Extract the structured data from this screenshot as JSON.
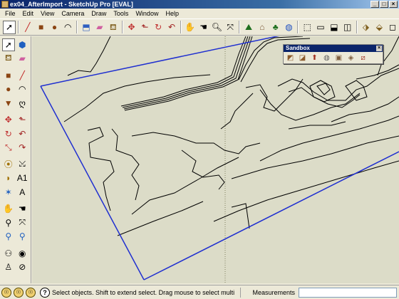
{
  "window": {
    "title": "ex04_AfterImport - SketchUp Pro [EVAL]",
    "minimize": "_",
    "maximize": "□",
    "close": "×"
  },
  "menu": [
    "File",
    "Edit",
    "View",
    "Camera",
    "Draw",
    "Tools",
    "Window",
    "Help"
  ],
  "toolbar": {
    "icons": [
      "select",
      "pencil",
      "rectangle",
      "circle",
      "arc",
      "push-pull",
      "eraser",
      "paint-bucket",
      "move",
      "rotate",
      "offset",
      "orbit",
      "pan",
      "zoom",
      "zoom-extents",
      "terrain",
      "side-view",
      "front-view",
      "iso-view",
      "top-view",
      "style-1",
      "style-2",
      "style-3",
      "style-4"
    ]
  },
  "left_tools": [
    [
      "select",
      "component"
    ],
    [
      "paint",
      "eraser"
    ],
    [
      "rectangle",
      "line"
    ],
    [
      "circle",
      "arc"
    ],
    [
      "polygon",
      "freehand"
    ],
    [
      "move",
      "push-pull"
    ],
    [
      "rotate",
      "follow-me"
    ],
    [
      "scale",
      "offset"
    ],
    [
      "tape-measure",
      "dimension"
    ],
    [
      "protractor",
      "text"
    ],
    [
      "axes",
      "3d-text"
    ],
    [
      "orbit",
      "pan"
    ],
    [
      "zoom",
      "zoom-window"
    ],
    [
      "zoom-extents",
      "previous"
    ],
    [
      "walk",
      "look-around"
    ],
    [
      "position-camera",
      "section"
    ]
  ],
  "sandbox": {
    "title": "Sandbox",
    "close": "×",
    "tools": [
      "from-contours",
      "from-scratch",
      "smoove",
      "stamp",
      "drape",
      "add-detail",
      "flip-edge"
    ]
  },
  "statusbar": {
    "help": "?",
    "text": "Select objects. Shift to extend select. Drag mouse to select multiple.",
    "measurements_label": "Measurements",
    "measurements_value": ""
  },
  "colors": {
    "viewport_bg": "#dcdcc8",
    "boundary": "#1f2fd0",
    "contour": "#000000"
  }
}
